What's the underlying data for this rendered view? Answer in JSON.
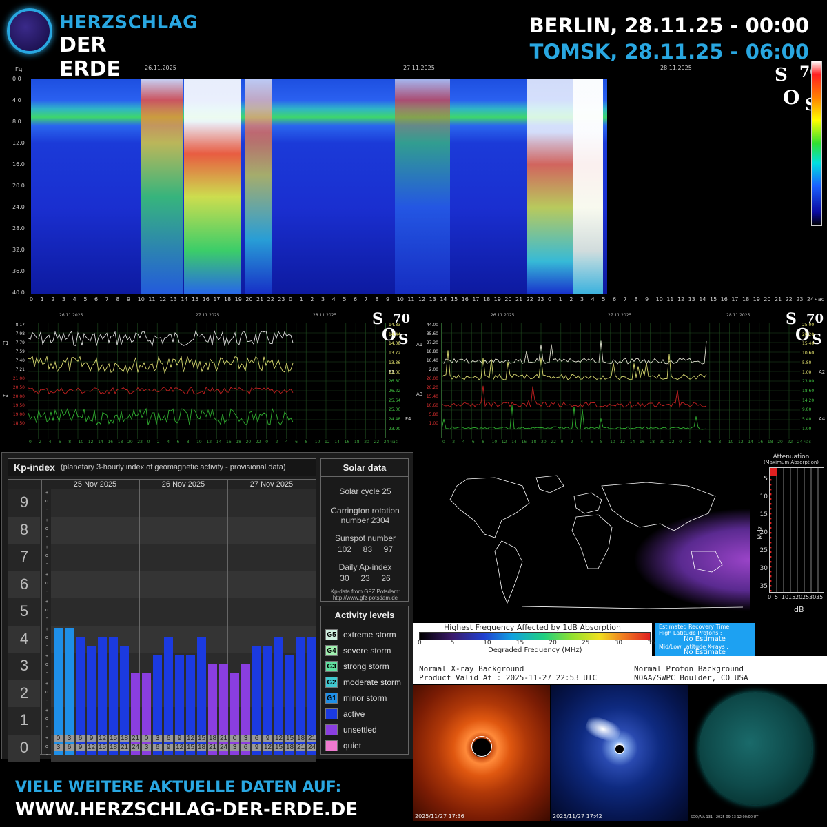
{
  "header": {
    "logo_line1": "HERZSCHLAG",
    "logo_line2": "DER ERDE",
    "berlin": "BERLIN, 28.11.25 - 00:00",
    "tomsk": "TOMSK, 28.11.25 - 06:00"
  },
  "spectrogram": {
    "y_unit": "Гц",
    "y_ticks": [
      "0.0",
      "4.0",
      "8.0",
      "12.0",
      "16.0",
      "20.0",
      "24.0",
      "28.0",
      "32.0",
      "36.0",
      "40.0"
    ],
    "dates": [
      "26.11.2025",
      "27.11.2025",
      "28.11.2025"
    ],
    "x_unit": "час",
    "hours_per_day": 24,
    "logo_text": [
      "S",
      "70",
      "O",
      "S"
    ]
  },
  "mini_left": {
    "dates": [
      "26.11.2025",
      "27.11.2025",
      "28.11.2025"
    ],
    "left_labels": [
      {
        "text": "8.17",
        "color": "#dddddd"
      },
      {
        "text": "7.98",
        "color": "#dddddd"
      },
      {
        "text": "7.79",
        "color": "#dddddd"
      },
      {
        "text": "7.59",
        "color": "#dddddd"
      },
      {
        "text": "7.40",
        "color": "#dddddd"
      },
      {
        "text": "7.21",
        "color": "#dddddd"
      },
      {
        "text": "21.00",
        "color": "#e03030"
      },
      {
        "text": "20.50",
        "color": "#e03030"
      },
      {
        "text": "20.00",
        "color": "#e03030"
      },
      {
        "text": "19.50",
        "color": "#e03030"
      },
      {
        "text": "19.00",
        "color": "#e03030"
      },
      {
        "text": "18.50",
        "color": "#e03030"
      }
    ],
    "right_labels": [
      {
        "text": "14.83",
        "color": "#e8e870"
      },
      {
        "text": "14.44",
        "color": "#e8e870"
      },
      {
        "text": "14.08",
        "color": "#e8e870"
      },
      {
        "text": "13.72",
        "color": "#e8e870"
      },
      {
        "text": "13.36",
        "color": "#e8e870"
      },
      {
        "text": "13.00",
        "color": "#e8e870"
      },
      {
        "text": "26.80",
        "color": "#40c040"
      },
      {
        "text": "26.22",
        "color": "#40c040"
      },
      {
        "text": "25.64",
        "color": "#40c040"
      },
      {
        "text": "25.06",
        "color": "#40c040"
      },
      {
        "text": "24.48",
        "color": "#40c040"
      },
      {
        "text": "23.90",
        "color": "#40c040"
      }
    ],
    "series_labels": [
      "F1",
      "F2",
      "F3",
      "F4"
    ],
    "x_ticks": [
      "0",
      "2",
      "4",
      "6",
      "8",
      "10",
      "12",
      "14",
      "16",
      "18",
      "20",
      "22",
      "0",
      "2",
      "4",
      "6",
      "8",
      "10",
      "12",
      "14",
      "16",
      "18",
      "20",
      "22",
      "0",
      "2",
      "4",
      "6",
      "8",
      "10",
      "12",
      "14",
      "16",
      "18",
      "20",
      "22",
      "24 час"
    ]
  },
  "mini_right": {
    "dates": [
      "26.11.2025",
      "27.11.2025",
      "28.11.2025"
    ],
    "left_labels": [
      {
        "text": "44.00",
        "color": "#dddddd"
      },
      {
        "text": "35.60",
        "color": "#dddddd"
      },
      {
        "text": "27.20",
        "color": "#dddddd"
      },
      {
        "text": "18.80",
        "color": "#dddddd"
      },
      {
        "text": "10.40",
        "color": "#dddddd"
      },
      {
        "text": "2.00",
        "color": "#dddddd"
      },
      {
        "text": "26.00",
        "color": "#e03030"
      },
      {
        "text": "20.20",
        "color": "#e03030"
      },
      {
        "text": "15.40",
        "color": "#e03030"
      },
      {
        "text": "10.60",
        "color": "#e03030"
      },
      {
        "text": "5.80",
        "color": "#e03030"
      },
      {
        "text": "1.00",
        "color": "#e03030"
      }
    ],
    "right_labels": [
      {
        "text": "25.00",
        "color": "#e8e870"
      },
      {
        "text": "20.20",
        "color": "#e8e870"
      },
      {
        "text": "15.40",
        "color": "#e8e870"
      },
      {
        "text": "10.60",
        "color": "#e8e870"
      },
      {
        "text": "5.80",
        "color": "#e8e870"
      },
      {
        "text": "1.00",
        "color": "#e8e870"
      },
      {
        "text": "23.00",
        "color": "#40c040"
      },
      {
        "text": "18.60",
        "color": "#40c040"
      },
      {
        "text": "14.20",
        "color": "#40c040"
      },
      {
        "text": "9.80",
        "color": "#40c040"
      },
      {
        "text": "5.40",
        "color": "#40c040"
      },
      {
        "text": "1.00",
        "color": "#40c040"
      }
    ],
    "series_labels": [
      "A1",
      "A2",
      "A3",
      "A4"
    ],
    "x_ticks": [
      "0",
      "2",
      "4",
      "6",
      "8",
      "10",
      "12",
      "14",
      "16",
      "18",
      "20",
      "22",
      "0",
      "2",
      "4",
      "6",
      "8",
      "10",
      "12",
      "14",
      "16",
      "18",
      "20",
      "22",
      "0",
      "2",
      "4",
      "6",
      "8",
      "10",
      "12",
      "14",
      "16",
      "18",
      "20",
      "22",
      "24 час"
    ]
  },
  "kp": {
    "title": "Kp-index",
    "subtitle": "(planetary 3-hourly index of geomagnetic activity - provisional data)",
    "levels": [
      "9",
      "8",
      "7",
      "6",
      "5",
      "4",
      "3",
      "2",
      "1",
      "0"
    ],
    "days": [
      "25 Nov 2025",
      "26 Nov 2025",
      "27 Nov 2025"
    ],
    "time_top": [
      "0",
      "3",
      "6",
      "9",
      "12",
      "15",
      "18",
      "21"
    ],
    "time_bottom": [
      "3",
      "6",
      "9",
      "12",
      "15",
      "18",
      "21",
      "24"
    ],
    "values": [
      4.67,
      4.67,
      4.33,
      4.0,
      4.33,
      4.33,
      4.0,
      3.0,
      3.0,
      3.67,
      4.33,
      3.67,
      3.67,
      4.33,
      3.33,
      3.33,
      3.0,
      3.33,
      4.0,
      4.0,
      4.33,
      3.67,
      4.33,
      4.33
    ],
    "bar_colors": [
      "#1e8fe8",
      "#1e8fe8",
      "#1b3ae0",
      "#1b3ae0",
      "#1b3ae0",
      "#1b3ae0",
      "#1b3ae0",
      "#8a3ee0",
      "#8a3ee0",
      "#1b3ae0",
      "#1b3ae0",
      "#1b3ae0",
      "#1b3ae0",
      "#1b3ae0",
      "#8a3ee0",
      "#8a3ee0",
      "#8a3ee0",
      "#8a3ee0",
      "#1b3ae0",
      "#1b3ae0",
      "#1b3ae0",
      "#1b3ae0",
      "#1b3ae0",
      "#1b3ae0"
    ]
  },
  "solar": {
    "title": "Solar data",
    "cycle": "Solar cycle 25",
    "carrington_1": "Carrington rotation",
    "carrington_2": "number 2304",
    "sunspot_label": "Sunspot number",
    "sunspot_values": "102     83     97",
    "ap_label": "Daily Ap-index",
    "ap_values": "30     23     26",
    "source_1": "Kp-data from GFZ Potsdam:",
    "source_2": "http://www.gfz-potsdam.de"
  },
  "activity": {
    "title": "Activity levels",
    "items": [
      {
        "code": "G5",
        "label": "extreme storm",
        "color": "#d0f0e0"
      },
      {
        "code": "G4",
        "label": "severe storm",
        "color": "#a0f0b0"
      },
      {
        "code": "G3",
        "label": "strong storm",
        "color": "#60e0a0"
      },
      {
        "code": "G2",
        "label": "moderate storm",
        "color": "#40c8d0"
      },
      {
        "code": "G1",
        "label": "minor storm",
        "color": "#1e8fe8"
      },
      {
        "code": "",
        "label": "active",
        "color": "#1b3ae0"
      },
      {
        "code": "",
        "label": "unsettled",
        "color": "#8a3ee0"
      },
      {
        "code": "",
        "label": "quiet",
        "color": "#f07ad0"
      }
    ]
  },
  "attenuation": {
    "title_1": "Attenuation",
    "title_2": "(Maximum Absorption)",
    "y_label": "MHz",
    "y_ticks": [
      "5",
      "10",
      "15",
      "20",
      "25",
      "30",
      "35"
    ],
    "x_ticks": [
      "0",
      "5",
      "10",
      "15",
      "20",
      "25",
      "30",
      "35"
    ],
    "x_label": "dB"
  },
  "map_legend": {
    "title": "Highest Frequency Affected by 1dB Absorption",
    "ticks": [
      "0",
      "5",
      "10",
      "15",
      "20",
      "25",
      "30",
      "35"
    ],
    "xlabel": "Degraded Frequency (MHz)"
  },
  "recovery": {
    "title": "Estimated Recovery Time",
    "high_label": "High Latitude Protons :",
    "high_value": "No Estimate",
    "mid_label": "Mid/Low Latitude X-rays :",
    "mid_value": "No Estimate"
  },
  "background_text": {
    "xray": "Normal X-ray Background",
    "valid": "Product Valid At : 2025-11-27 22:53 UTC",
    "proton": "Normal Proton Background",
    "noaa": "NOAA/SWPC Boulder, CO USA"
  },
  "sun_images": {
    "c2_stamp": "2025/11/27 17:36",
    "c3_stamp": "2025/11/27 17:42",
    "sdo_stamp": "SDO/AIA 131   2025-09-13 12:00:00 UT"
  },
  "footer": {
    "line1": "VIELE WEITERE AKTUELLE DATEN AUF:",
    "line2": "WWW.HERZSCHLAG-DER-ERDE.DE"
  }
}
